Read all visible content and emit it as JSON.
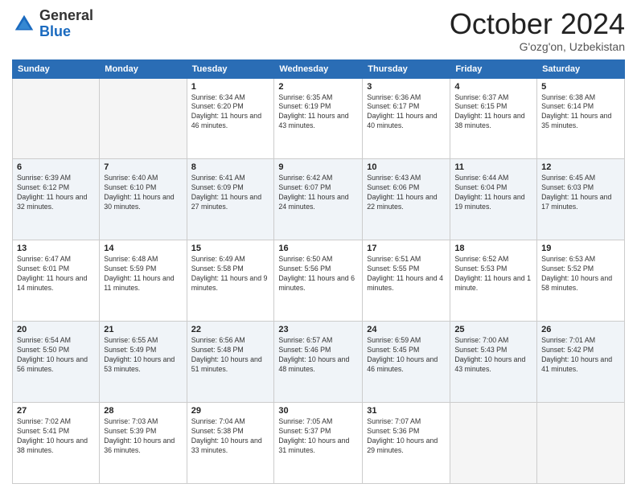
{
  "header": {
    "logo_general": "General",
    "logo_blue": "Blue",
    "month_title": "October 2024",
    "location": "G'ozg'on, Uzbekistan"
  },
  "weekdays": [
    "Sunday",
    "Monday",
    "Tuesday",
    "Wednesday",
    "Thursday",
    "Friday",
    "Saturday"
  ],
  "weeks": [
    [
      {
        "day": "",
        "info": ""
      },
      {
        "day": "",
        "info": ""
      },
      {
        "day": "1",
        "info": "Sunrise: 6:34 AM\nSunset: 6:20 PM\nDaylight: 11 hours and 46 minutes."
      },
      {
        "day": "2",
        "info": "Sunrise: 6:35 AM\nSunset: 6:19 PM\nDaylight: 11 hours and 43 minutes."
      },
      {
        "day": "3",
        "info": "Sunrise: 6:36 AM\nSunset: 6:17 PM\nDaylight: 11 hours and 40 minutes."
      },
      {
        "day": "4",
        "info": "Sunrise: 6:37 AM\nSunset: 6:15 PM\nDaylight: 11 hours and 38 minutes."
      },
      {
        "day": "5",
        "info": "Sunrise: 6:38 AM\nSunset: 6:14 PM\nDaylight: 11 hours and 35 minutes."
      }
    ],
    [
      {
        "day": "6",
        "info": "Sunrise: 6:39 AM\nSunset: 6:12 PM\nDaylight: 11 hours and 32 minutes."
      },
      {
        "day": "7",
        "info": "Sunrise: 6:40 AM\nSunset: 6:10 PM\nDaylight: 11 hours and 30 minutes."
      },
      {
        "day": "8",
        "info": "Sunrise: 6:41 AM\nSunset: 6:09 PM\nDaylight: 11 hours and 27 minutes."
      },
      {
        "day": "9",
        "info": "Sunrise: 6:42 AM\nSunset: 6:07 PM\nDaylight: 11 hours and 24 minutes."
      },
      {
        "day": "10",
        "info": "Sunrise: 6:43 AM\nSunset: 6:06 PM\nDaylight: 11 hours and 22 minutes."
      },
      {
        "day": "11",
        "info": "Sunrise: 6:44 AM\nSunset: 6:04 PM\nDaylight: 11 hours and 19 minutes."
      },
      {
        "day": "12",
        "info": "Sunrise: 6:45 AM\nSunset: 6:03 PM\nDaylight: 11 hours and 17 minutes."
      }
    ],
    [
      {
        "day": "13",
        "info": "Sunrise: 6:47 AM\nSunset: 6:01 PM\nDaylight: 11 hours and 14 minutes."
      },
      {
        "day": "14",
        "info": "Sunrise: 6:48 AM\nSunset: 5:59 PM\nDaylight: 11 hours and 11 minutes."
      },
      {
        "day": "15",
        "info": "Sunrise: 6:49 AM\nSunset: 5:58 PM\nDaylight: 11 hours and 9 minutes."
      },
      {
        "day": "16",
        "info": "Sunrise: 6:50 AM\nSunset: 5:56 PM\nDaylight: 11 hours and 6 minutes."
      },
      {
        "day": "17",
        "info": "Sunrise: 6:51 AM\nSunset: 5:55 PM\nDaylight: 11 hours and 4 minutes."
      },
      {
        "day": "18",
        "info": "Sunrise: 6:52 AM\nSunset: 5:53 PM\nDaylight: 11 hours and 1 minute."
      },
      {
        "day": "19",
        "info": "Sunrise: 6:53 AM\nSunset: 5:52 PM\nDaylight: 10 hours and 58 minutes."
      }
    ],
    [
      {
        "day": "20",
        "info": "Sunrise: 6:54 AM\nSunset: 5:50 PM\nDaylight: 10 hours and 56 minutes."
      },
      {
        "day": "21",
        "info": "Sunrise: 6:55 AM\nSunset: 5:49 PM\nDaylight: 10 hours and 53 minutes."
      },
      {
        "day": "22",
        "info": "Sunrise: 6:56 AM\nSunset: 5:48 PM\nDaylight: 10 hours and 51 minutes."
      },
      {
        "day": "23",
        "info": "Sunrise: 6:57 AM\nSunset: 5:46 PM\nDaylight: 10 hours and 48 minutes."
      },
      {
        "day": "24",
        "info": "Sunrise: 6:59 AM\nSunset: 5:45 PM\nDaylight: 10 hours and 46 minutes."
      },
      {
        "day": "25",
        "info": "Sunrise: 7:00 AM\nSunset: 5:43 PM\nDaylight: 10 hours and 43 minutes."
      },
      {
        "day": "26",
        "info": "Sunrise: 7:01 AM\nSunset: 5:42 PM\nDaylight: 10 hours and 41 minutes."
      }
    ],
    [
      {
        "day": "27",
        "info": "Sunrise: 7:02 AM\nSunset: 5:41 PM\nDaylight: 10 hours and 38 minutes."
      },
      {
        "day": "28",
        "info": "Sunrise: 7:03 AM\nSunset: 5:39 PM\nDaylight: 10 hours and 36 minutes."
      },
      {
        "day": "29",
        "info": "Sunrise: 7:04 AM\nSunset: 5:38 PM\nDaylight: 10 hours and 33 minutes."
      },
      {
        "day": "30",
        "info": "Sunrise: 7:05 AM\nSunset: 5:37 PM\nDaylight: 10 hours and 31 minutes."
      },
      {
        "day": "31",
        "info": "Sunrise: 7:07 AM\nSunset: 5:36 PM\nDaylight: 10 hours and 29 minutes."
      },
      {
        "day": "",
        "info": ""
      },
      {
        "day": "",
        "info": ""
      }
    ]
  ]
}
